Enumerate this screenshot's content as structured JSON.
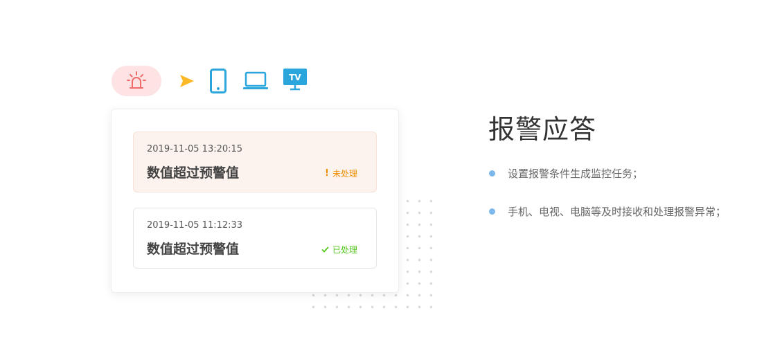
{
  "icons": {
    "alarm": "siren-icon",
    "arrow": "arrow-right-icon",
    "phone": "phone-icon",
    "laptop": "laptop-icon",
    "tv": "tv-icon",
    "tv_label": "TV"
  },
  "colors": {
    "alarm_bg": "#fde3e3",
    "alarm_icon": "#f06a6a",
    "arrow": "#fbb928",
    "device": "#2aa6dc",
    "pending_status": "#f08c00",
    "done_status": "#52c41a",
    "bullet": "#7cb8ec"
  },
  "alerts": [
    {
      "time": "2019-11-05 13:20:15",
      "title": "数值超过预警值",
      "status_icon": "exclamation-icon",
      "status": "未处理"
    },
    {
      "time": "2019-11-05 11:12:33",
      "title": "数值超过预警值",
      "status_icon": "check-icon",
      "status": "已处理"
    }
  ],
  "feature": {
    "title": "报警应答",
    "bullets": [
      "设置报警条件生成监控任务；",
      "手机、电视、电脑等及时接收和处理报警异常；"
    ]
  }
}
